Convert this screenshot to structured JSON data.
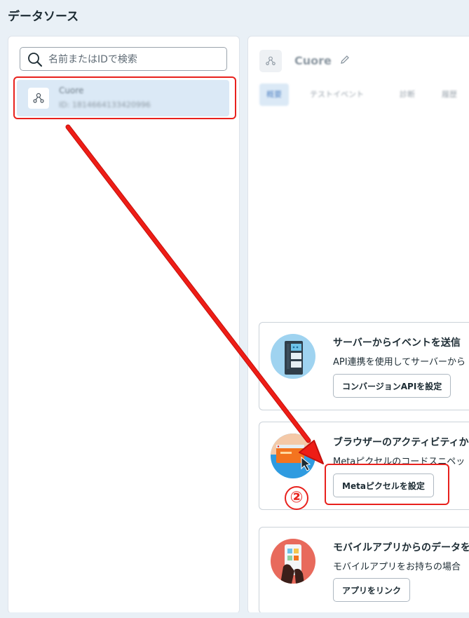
{
  "page": {
    "title": "データソース"
  },
  "search": {
    "placeholder": "名前またはIDで検索"
  },
  "datasource": {
    "name": "Cuore",
    "id_text": "ID: 1814664133420996"
  },
  "detail": {
    "title": "Cuore",
    "tabs": [
      "概要",
      "テストイベント",
      "診断",
      "履歴"
    ]
  },
  "cards": [
    {
      "title": "サーバーからイベントを送信",
      "desc": "API連携を使用してサーバーから",
      "button": "コンバージョンAPIを設定",
      "illustration": "server-illustration-icon"
    },
    {
      "title": "ブラウザーのアクティビティからウ",
      "desc": "Metaピクセルのコードスニペッ",
      "button": "Metaピクセルを設定",
      "illustration": "browser-illustration-icon"
    },
    {
      "title": "モバイルアプリからのデータを共",
      "desc": "モバイルアプリをお持ちの場合",
      "button": "アプリをリンク",
      "illustration": "mobile-illustration-icon"
    }
  ],
  "annotation": {
    "step_label": "②",
    "color": "#e8211d"
  },
  "colors": {
    "accent": "#dbe9f6",
    "annotation": "#e8211d",
    "text": "#1c2b33"
  }
}
